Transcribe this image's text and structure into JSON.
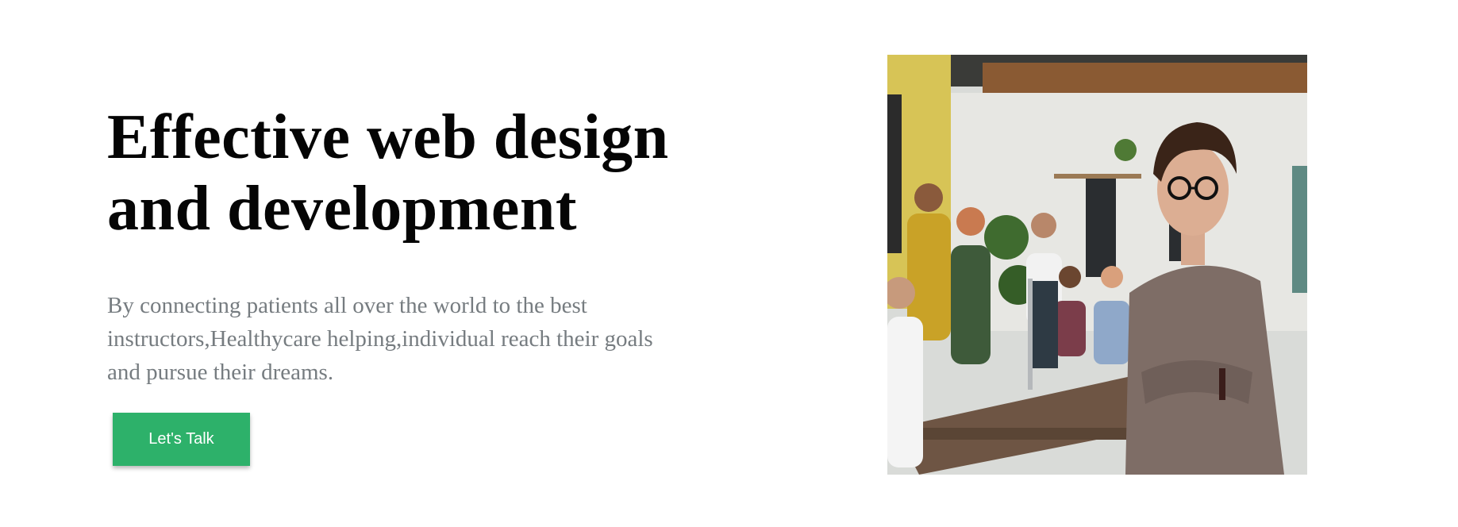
{
  "hero": {
    "title_line1": "Effective web design",
    "title_line2": "and development",
    "description_line1": "By connecting patients all over the world to the best",
    "description_line2": "instructors,Healthycare helping,individual reach their goals",
    "description_line3": "and pursue their dreams.",
    "cta_label": "Let's Talk"
  },
  "photo": {
    "subject": "office-team-photo",
    "alt": "Team meeting in an office with a woman in the foreground"
  },
  "colors": {
    "cta_background": "#2db16a",
    "title": "#050505",
    "description": "#767c80"
  }
}
